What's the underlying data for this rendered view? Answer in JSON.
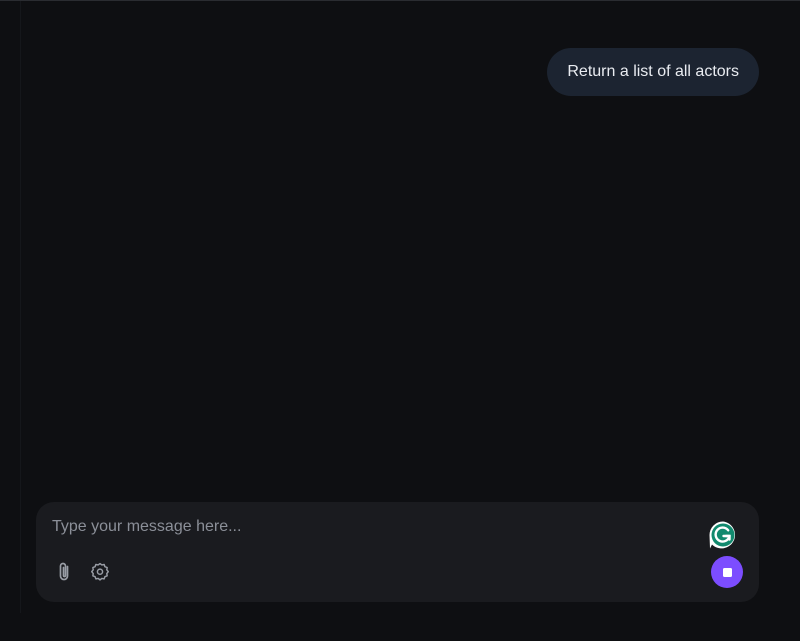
{
  "conversation": {
    "messages": [
      {
        "role": "user",
        "text": "Return a list of all actors"
      }
    ]
  },
  "composer": {
    "placeholder": "Type your message here...",
    "value": "",
    "attach_icon": "paperclip-icon",
    "settings_icon": "gear-icon",
    "grammarly_icon": "grammarly-icon",
    "stop_icon": "stop-icon"
  },
  "colors": {
    "background": "#0e0f12",
    "user_bubble": "#1c2431",
    "composer": "#1a1b1f",
    "accent": "#7c4dff",
    "grammarly": "#15c39a"
  }
}
